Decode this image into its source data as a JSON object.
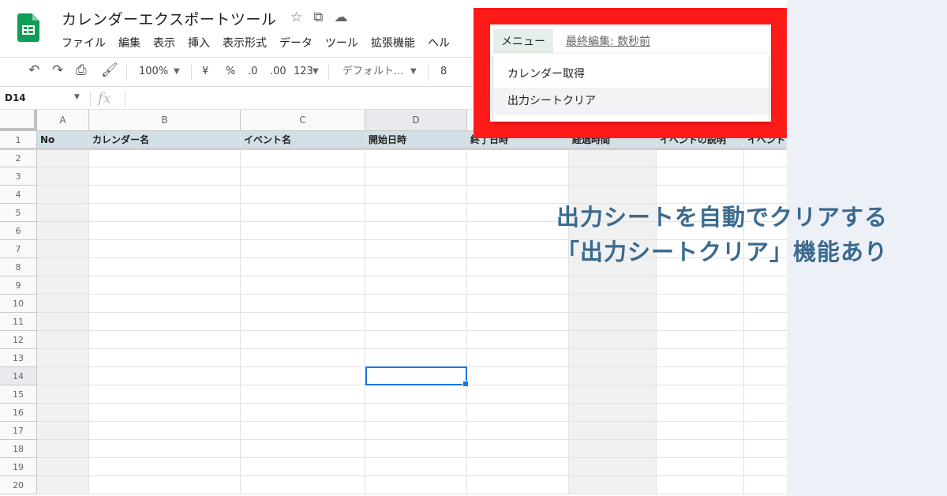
{
  "doc_title": "カレンダーエクスポートツール",
  "title_icons": [
    "star-icon",
    "move-folder-icon",
    "cloud-saved-icon"
  ],
  "menubar": [
    "ファイル",
    "編集",
    "表示",
    "挿入",
    "表示形式",
    "データ",
    "ツール",
    "拡張機能",
    "ヘル"
  ],
  "toolbar": {
    "zoom": "100%",
    "currency": "¥",
    "percent": "%",
    "dec_less": ".0",
    "dec_more": ".00",
    "format_more": "123",
    "font": "デフォルト...",
    "font_size": "8"
  },
  "formula_bar": {
    "cell_ref": "D14",
    "fx": "fx"
  },
  "columns": [
    "A",
    "B",
    "C",
    "D",
    "",
    "",
    "",
    ""
  ],
  "header_row": [
    "No",
    "カレンダー名",
    "イベント名",
    "開始日時",
    "終了日時",
    "経過時間",
    "イベントの説明",
    "イベント"
  ],
  "rows": [
    1,
    2,
    3,
    4,
    5,
    6,
    7,
    8,
    9,
    10,
    11,
    12,
    13,
    14,
    15,
    16,
    17,
    18,
    19,
    20
  ],
  "selected_cell": "D14",
  "custom_menu": {
    "label": "メニュー",
    "last_edit": "最終編集: 数秒前",
    "items": [
      "カレンダー取得",
      "出力シートクリア"
    ]
  },
  "caption": [
    "出力シートを自動でクリアする",
    "「出力シートクリア」機能あり"
  ],
  "colors": {
    "annotation_red": "#ff1a1a",
    "caption_blue": "#3a6a8f",
    "header_fill": "#d1e0e7",
    "sheets_green": "#0f9d58"
  }
}
